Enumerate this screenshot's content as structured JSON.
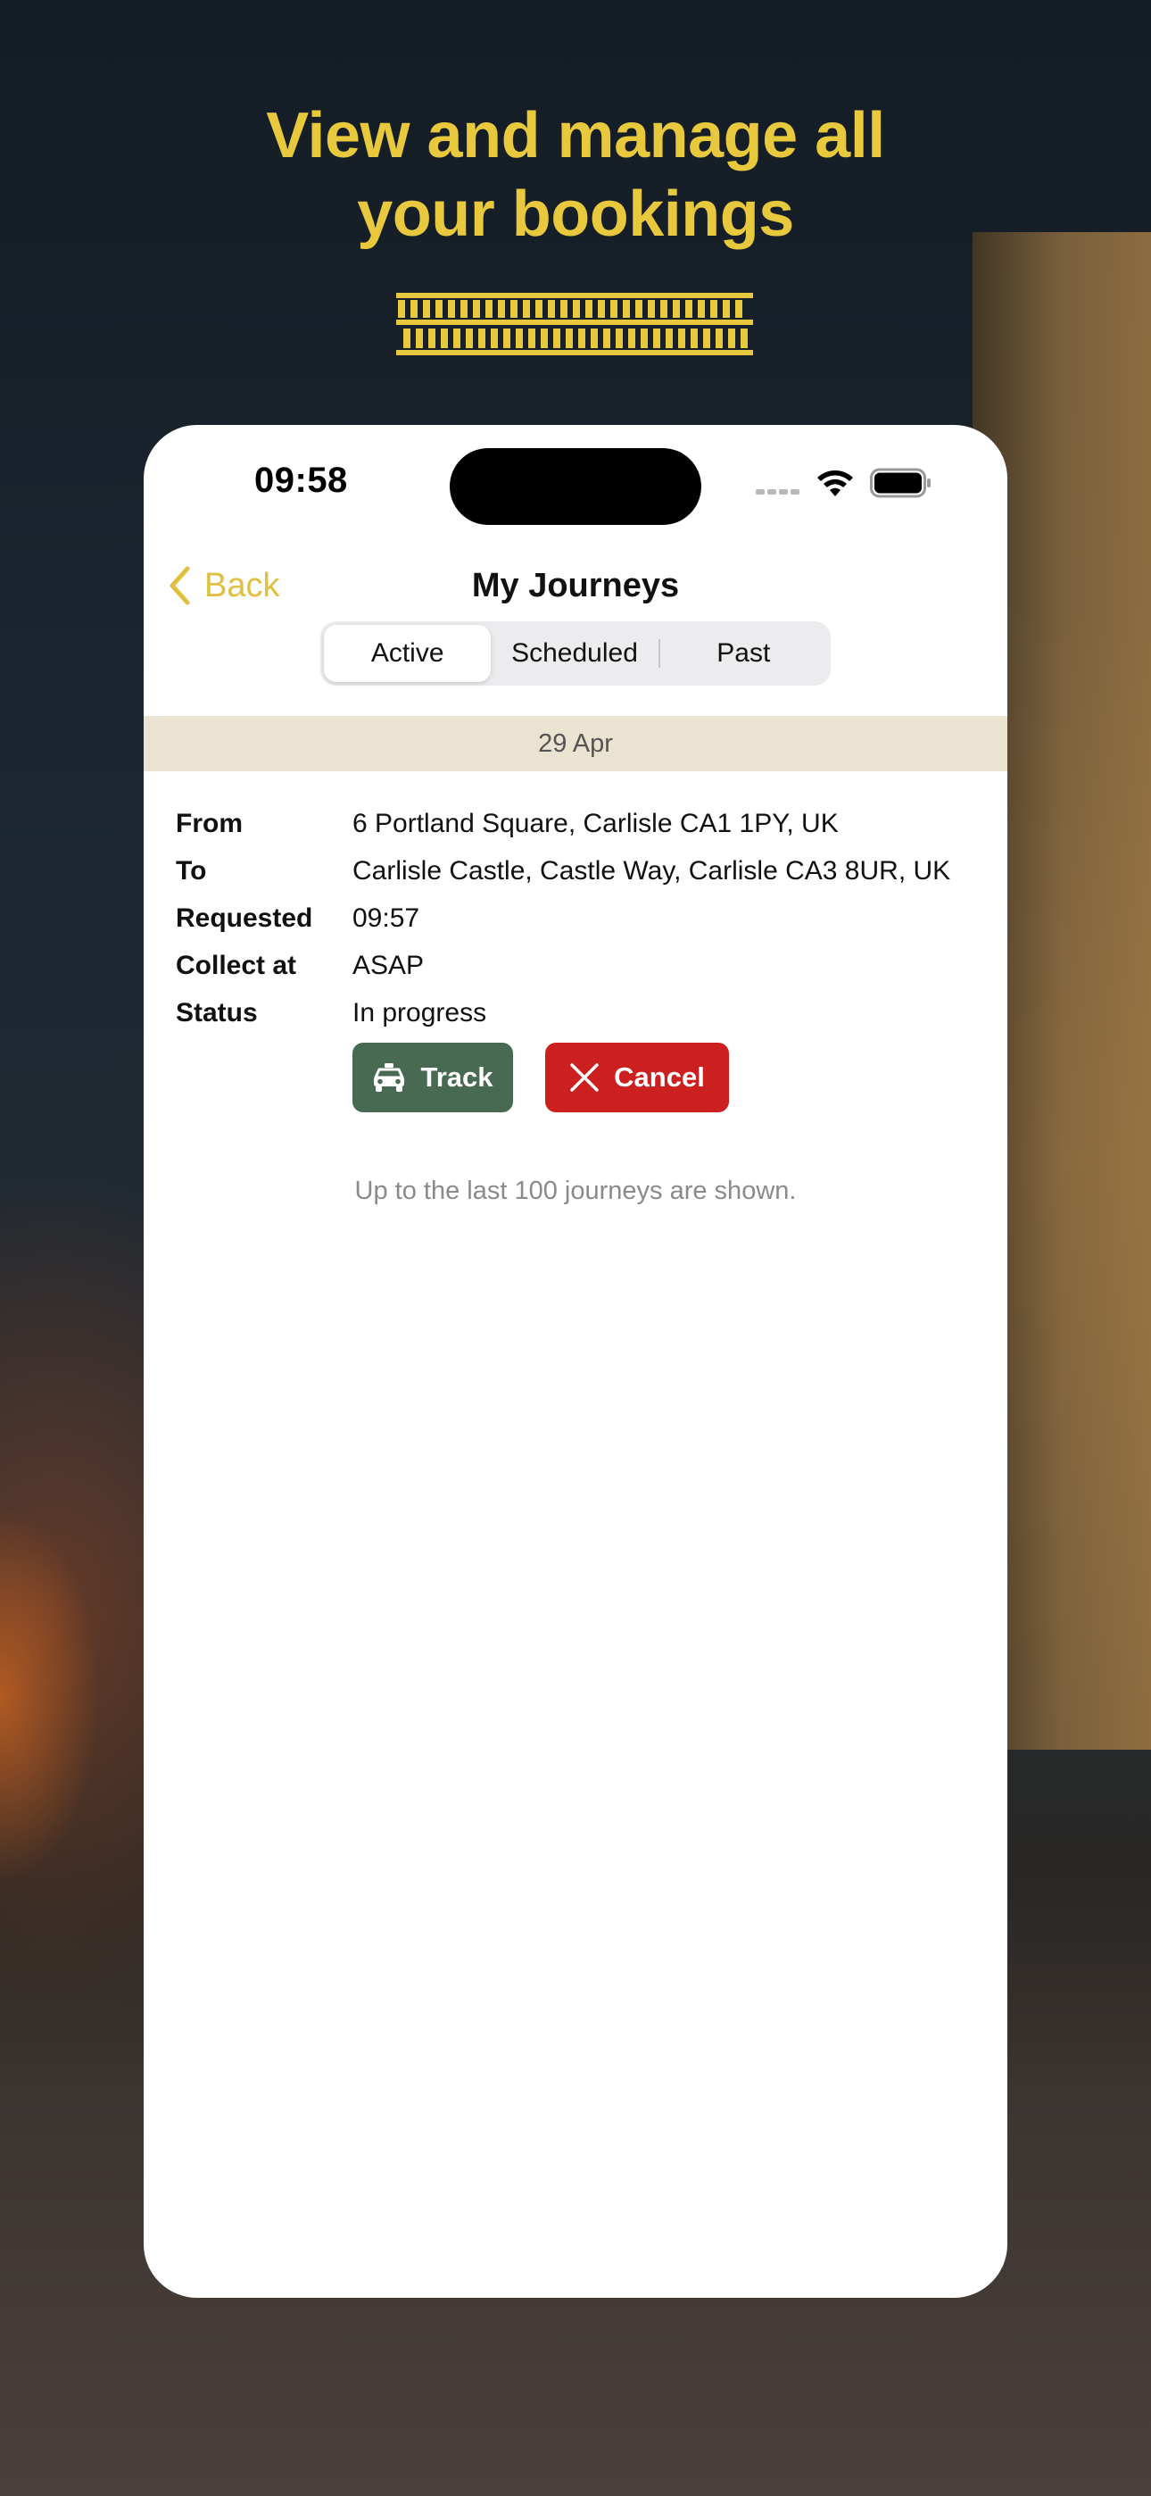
{
  "headline": {
    "line1": "View and manage all",
    "line2": "your bookings"
  },
  "colors": {
    "accent": "#e8c83c",
    "track": "#486a52",
    "cancel": "#cc1f1f",
    "date_bar": "#ebe3d1"
  },
  "status_bar": {
    "time": "09:58",
    "icons": [
      "signal-icon",
      "wifi-icon",
      "battery-icon"
    ]
  },
  "nav": {
    "back_label": "Back",
    "title": "My Journeys"
  },
  "tabs": [
    {
      "label": "Active",
      "selected": true
    },
    {
      "label": "Scheduled",
      "selected": false
    },
    {
      "label": "Past",
      "selected": false
    }
  ],
  "journey": {
    "date": "29 Apr",
    "from_label": "From",
    "from": "6 Portland Square, Carlisle CA1 1PY, UK",
    "to_label": "To",
    "to": "Carlisle Castle, Castle Way, Carlisle CA3 8UR, UK",
    "requested_label": "Requested",
    "requested": "09:57",
    "collect_label": "Collect at",
    "collect": "ASAP",
    "status_label": "Status",
    "status": "In progress",
    "track_label": "Track",
    "cancel_label": "Cancel"
  },
  "footer_note": "Up to the last 100 journeys are shown."
}
